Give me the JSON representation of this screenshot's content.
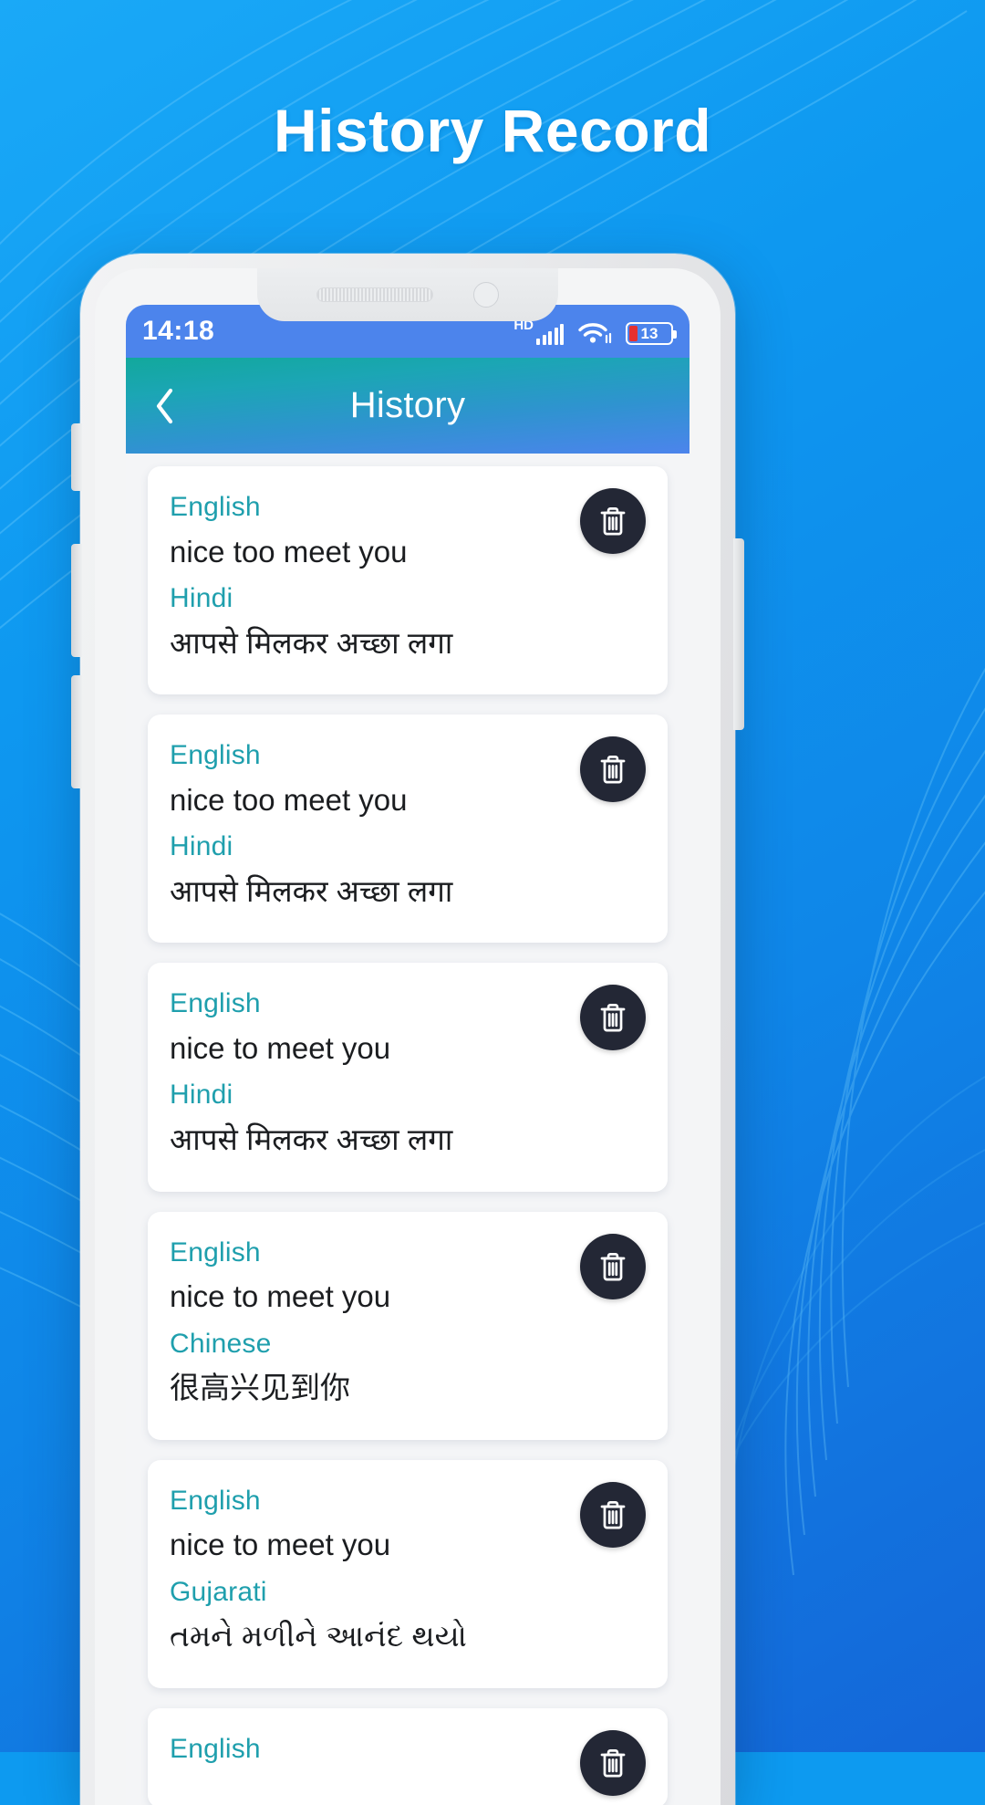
{
  "promo": {
    "title": "History Record",
    "accent": "#0d9af0"
  },
  "phone": {
    "status_bar": {
      "time": "14:18",
      "hd_label": "HD",
      "signal_icon": "signal-bars-icon",
      "wifi_icon": "wifi-icon",
      "battery_level": "13",
      "battery_icon": "battery-icon",
      "bg_color": "#4c84ec"
    },
    "header": {
      "title": "History",
      "back_icon": "chevron-left-icon",
      "gradient_from": "#12a89c",
      "gradient_to": "#4c84ec"
    }
  },
  "history": {
    "label_color": "#1f9fad",
    "delete_icon": "trash-icon",
    "delete_button_color": "#232735",
    "items": [
      {
        "source_language": "English",
        "source_text": "nice too meet you",
        "target_language": "Hindi",
        "target_text": "आपसे मिलकर अच्छा लगा",
        "delete_label": "Delete"
      },
      {
        "source_language": "English",
        "source_text": "nice too meet you",
        "target_language": "Hindi",
        "target_text": "आपसे मिलकर अच्छा लगा",
        "delete_label": "Delete"
      },
      {
        "source_language": "English",
        "source_text": "nice to meet you",
        "target_language": "Hindi",
        "target_text": "आपसे मिलकर अच्छा लगा",
        "delete_label": "Delete"
      },
      {
        "source_language": "English",
        "source_text": "nice to meet you",
        "target_language": "Chinese",
        "target_text": "很高兴见到你",
        "delete_label": "Delete"
      },
      {
        "source_language": "English",
        "source_text": "nice to meet you",
        "target_language": "Gujarati",
        "target_text": "તમને મળીને આનંદ થયો",
        "delete_label": "Delete"
      },
      {
        "source_language": "English",
        "source_text": "",
        "target_language": "",
        "target_text": "",
        "delete_label": "Delete"
      }
    ]
  }
}
